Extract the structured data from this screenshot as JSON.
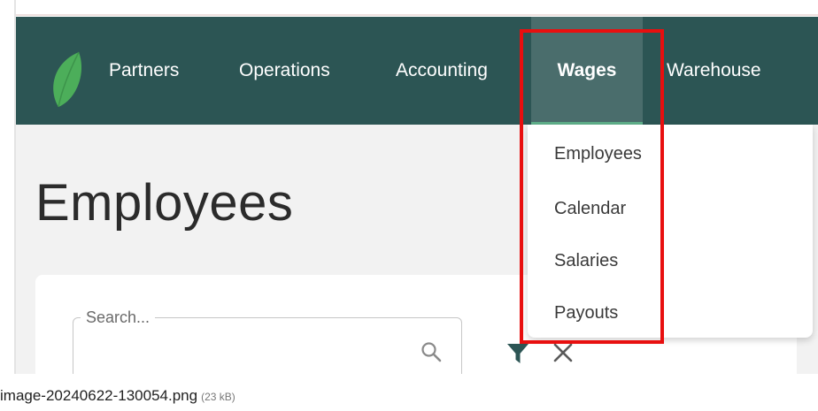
{
  "nav": {
    "items": [
      {
        "label": "Partners"
      },
      {
        "label": "Operations"
      },
      {
        "label": "Accounting"
      },
      {
        "label": "Wages"
      },
      {
        "label": "Warehouse"
      }
    ],
    "active": "Wages"
  },
  "page": {
    "title": "Employees"
  },
  "search": {
    "label": "Search..."
  },
  "dropdown": {
    "items": [
      {
        "label": "Employees"
      },
      {
        "label": "Calendar"
      },
      {
        "label": "Salaries"
      },
      {
        "label": "Payouts"
      }
    ]
  },
  "attachment": {
    "filename": "image-20240622-130054.png",
    "size": "(23 kB)"
  },
  "colors": {
    "navbar": "#2c5554",
    "active_nav": "#4a6d6c",
    "logo_green": "#4cae5a",
    "highlight_red": "#e80f0f",
    "content_bg": "#f2f2f2"
  },
  "icons": [
    "leaf-logo-icon",
    "search-icon",
    "filter-icon",
    "close-icon"
  ]
}
